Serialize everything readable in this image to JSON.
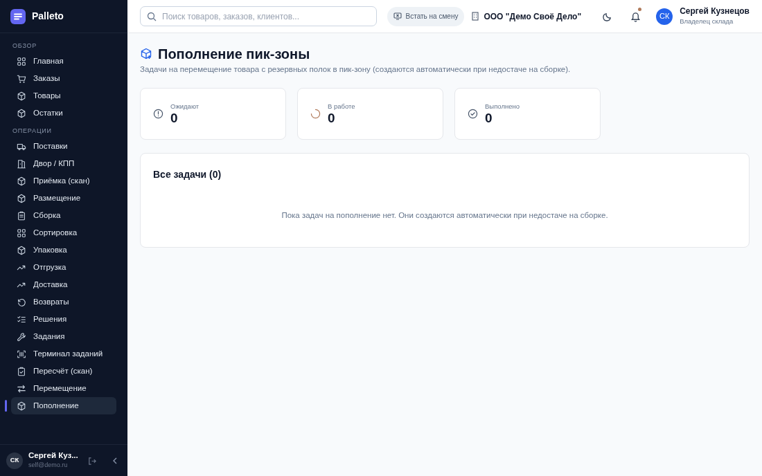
{
  "brand": {
    "name": "Palleto"
  },
  "sidebar": {
    "sections": [
      {
        "title": "ОБЗОР",
        "items": [
          {
            "label": "Главная",
            "selected": false
          },
          {
            "label": "Заказы",
            "selected": false
          },
          {
            "label": "Товары",
            "selected": false
          },
          {
            "label": "Остатки",
            "selected": false
          }
        ]
      },
      {
        "title": "ОПЕРАЦИИ",
        "items": [
          {
            "label": "Поставки",
            "selected": false
          },
          {
            "label": "Двор / КПП",
            "selected": false
          },
          {
            "label": "Приёмка (скан)",
            "selected": false
          },
          {
            "label": "Размещение",
            "selected": false
          },
          {
            "label": "Сборка",
            "selected": false
          },
          {
            "label": "Сортировка",
            "selected": false
          },
          {
            "label": "Упаковка",
            "selected": false
          },
          {
            "label": "Отгрузка",
            "selected": false
          },
          {
            "label": "Доставка",
            "selected": false
          },
          {
            "label": "Возвраты",
            "selected": false
          },
          {
            "label": "Решения",
            "selected": false
          },
          {
            "label": "Задания",
            "selected": false
          },
          {
            "label": "Терминал заданий",
            "selected": false
          },
          {
            "label": "Пересчёт (скан)",
            "selected": false
          },
          {
            "label": "Перемещение",
            "selected": false
          },
          {
            "label": "Пополнение",
            "selected": true
          }
        ]
      }
    ],
    "user": {
      "initials": "СК",
      "name": "Сергей Куз...",
      "email": "self@demo.ru"
    }
  },
  "header": {
    "search": {
      "placeholder": "Поиск товаров, заказов, клиентов..."
    },
    "shift_button": "Встать на смену",
    "company": "ООО \"Демо Своё Дело\"",
    "notifications_unread": true,
    "user": {
      "initials": "СК",
      "name": "Сергей Кузнецов",
      "role": "Владелец склада"
    }
  },
  "page": {
    "title": "Пополнение пик-зоны",
    "subtitle": "Задачи на перемещение товара с резервных полок в пик-зону (создаются автоматически при недостаче на сборке).",
    "stats": [
      {
        "kind": "pending",
        "label": "Ожидают",
        "value": "0"
      },
      {
        "kind": "progress",
        "label": "В работе",
        "value": "0"
      },
      {
        "kind": "done",
        "label": "Выполнено",
        "value": "0"
      }
    ],
    "tasks": {
      "title": "Все задачи (0)",
      "empty_text": "Пока задач на пополнение нет. Они создаются автоматически при недостаче на сборке."
    }
  }
}
